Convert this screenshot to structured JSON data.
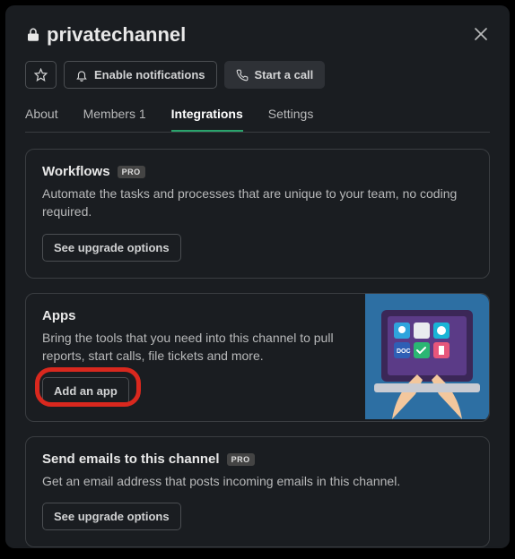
{
  "header": {
    "channel_name": "privatechannel"
  },
  "toolbar": {
    "notifications_label": "Enable notifications",
    "call_label": "Start a call"
  },
  "tabs": {
    "about": "About",
    "members": "Members 1",
    "integrations": "Integrations",
    "settings": "Settings"
  },
  "cards": {
    "workflows": {
      "title": "Workflows",
      "badge": "PRO",
      "desc": "Automate the tasks and processes that are unique to your team, no coding required.",
      "cta": "See upgrade options"
    },
    "apps": {
      "title": "Apps",
      "desc": "Bring the tools that you need into this channel to pull reports, start calls, file tickets and more.",
      "cta": "Add an app"
    },
    "emails": {
      "title": "Send emails to this channel",
      "badge": "PRO",
      "desc": "Get an email address that posts incoming emails in this channel.",
      "cta": "See upgrade options"
    }
  }
}
